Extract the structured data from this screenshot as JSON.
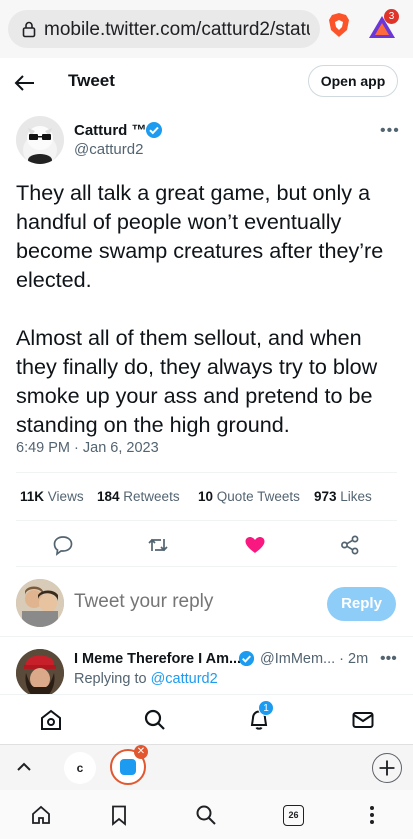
{
  "browser": {
    "url": "mobile.twitter.com/catturd2/status",
    "rewards_count": "3",
    "tab_initial": "c",
    "tab_count": "26"
  },
  "header": {
    "title": "Tweet",
    "open_app": "Open app"
  },
  "tweet": {
    "author_name": "Catturd ™",
    "author_handle": "@catturd2",
    "paragraphs": [
      "They all talk a great game, but only a handful of people won’t eventually become swamp creatures after they’re elected.",
      "Almost all of them sellout, and when they finally do, they always try to blow smoke up your ass and pretend to be standing on the high ground."
    ],
    "timestamp": "6:49 PM · Jan 6, 2023",
    "stats": {
      "views_num": "11K",
      "views_label": "Views",
      "retweets_num": "184",
      "retweets_label": "Retweets",
      "quotes_num": "10",
      "quotes_label": "Quote Tweets",
      "likes_num": "973",
      "likes_label": "Likes"
    }
  },
  "composer": {
    "placeholder": "Tweet your reply",
    "reply_button": "Reply"
  },
  "reply": {
    "name": "I Meme Therefore I Am...",
    "handle": "@ImMem... · 2m",
    "replying_prefix": "Replying to ",
    "replying_to": "@catturd2"
  },
  "nav": {
    "notifications_badge": "1"
  },
  "colors": {
    "accent": "#1d9bf0",
    "like": "#f91880",
    "verified": "#1d9bf0"
  }
}
